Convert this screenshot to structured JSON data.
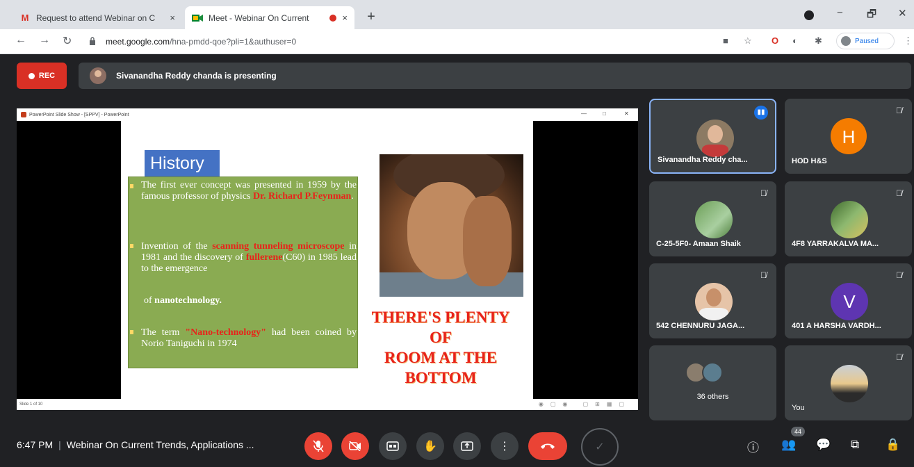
{
  "browser": {
    "tabs": [
      {
        "title": "Request to attend Webinar on C",
        "icon": "gmail-icon",
        "close": "×"
      },
      {
        "title": "Meet - Webinar On Current",
        "icon": "meet-icon",
        "close": "×"
      }
    ],
    "new_tab": "+",
    "url_host": "meet.google.com",
    "url_path": "/hna-pmdd-qoe?pli=1&authuser=0",
    "profile_status": "Paused",
    "window_controls": {
      "minimize": "−",
      "restore": "🗗",
      "close": "✕"
    }
  },
  "meet": {
    "rec_label": "REC",
    "presenting_text": "Sivanandha Reddy chanda is presenting"
  },
  "powerpoint": {
    "window_title": "PowerPoint Slide Show - [SPPV] - PowerPoint",
    "slide_status": "Slide 1 of 10"
  },
  "slide": {
    "title": "History",
    "para1_a": "The first ever concept was presented in 1959 by the famous professor of physics ",
    "para1_red": "Dr. Richard P.Feynman",
    "para1_b": ".",
    "para2_a": "Invention of the ",
    "para2_red1": "scanning tunneling microscope",
    "para2_b": " in 1981 and the discovery of ",
    "para2_red2": "fullerene",
    "para2_c": "(C60) in 1985 lead to the emergence",
    "para2_d": "of ",
    "para2_bold": "nanotechnology.",
    "para3_a": "The term ",
    "para3_red": "\"Nano-technology\"",
    "para3_b": " had been coined by Norio Taniguchi in 1974",
    "quote_line1": "THERE'S PLENTY",
    "quote_line2": "OF",
    "quote_line3": "ROOM AT THE",
    "quote_line4": "BOTTOM"
  },
  "participants": [
    {
      "name": "Sivanandha Reddy cha...",
      "speaking": true
    },
    {
      "name": "HOD H&S",
      "initial": "H",
      "color": "#f57c00"
    },
    {
      "name": "C-25-5F0- Amaan Shaik"
    },
    {
      "name": "4F8 YARRAKALVA MA..."
    },
    {
      "name": "542 CHENNURU JAGA..."
    },
    {
      "name": "401 A HARSHA VARDH...",
      "initial": "V",
      "color": "#5e35b1"
    },
    {
      "name": "36 others"
    },
    {
      "name": "You"
    }
  ],
  "footer": {
    "time": "6:47 PM",
    "separator": "|",
    "meeting_title": "Webinar On Current Trends, Applications ...",
    "people_count": "44"
  },
  "colors": {
    "meet_bg": "#202124",
    "tile_bg": "#3c4043",
    "red": "#ea4335",
    "slide_green": "#8aab52",
    "slide_title_blue": "#4472c4"
  }
}
